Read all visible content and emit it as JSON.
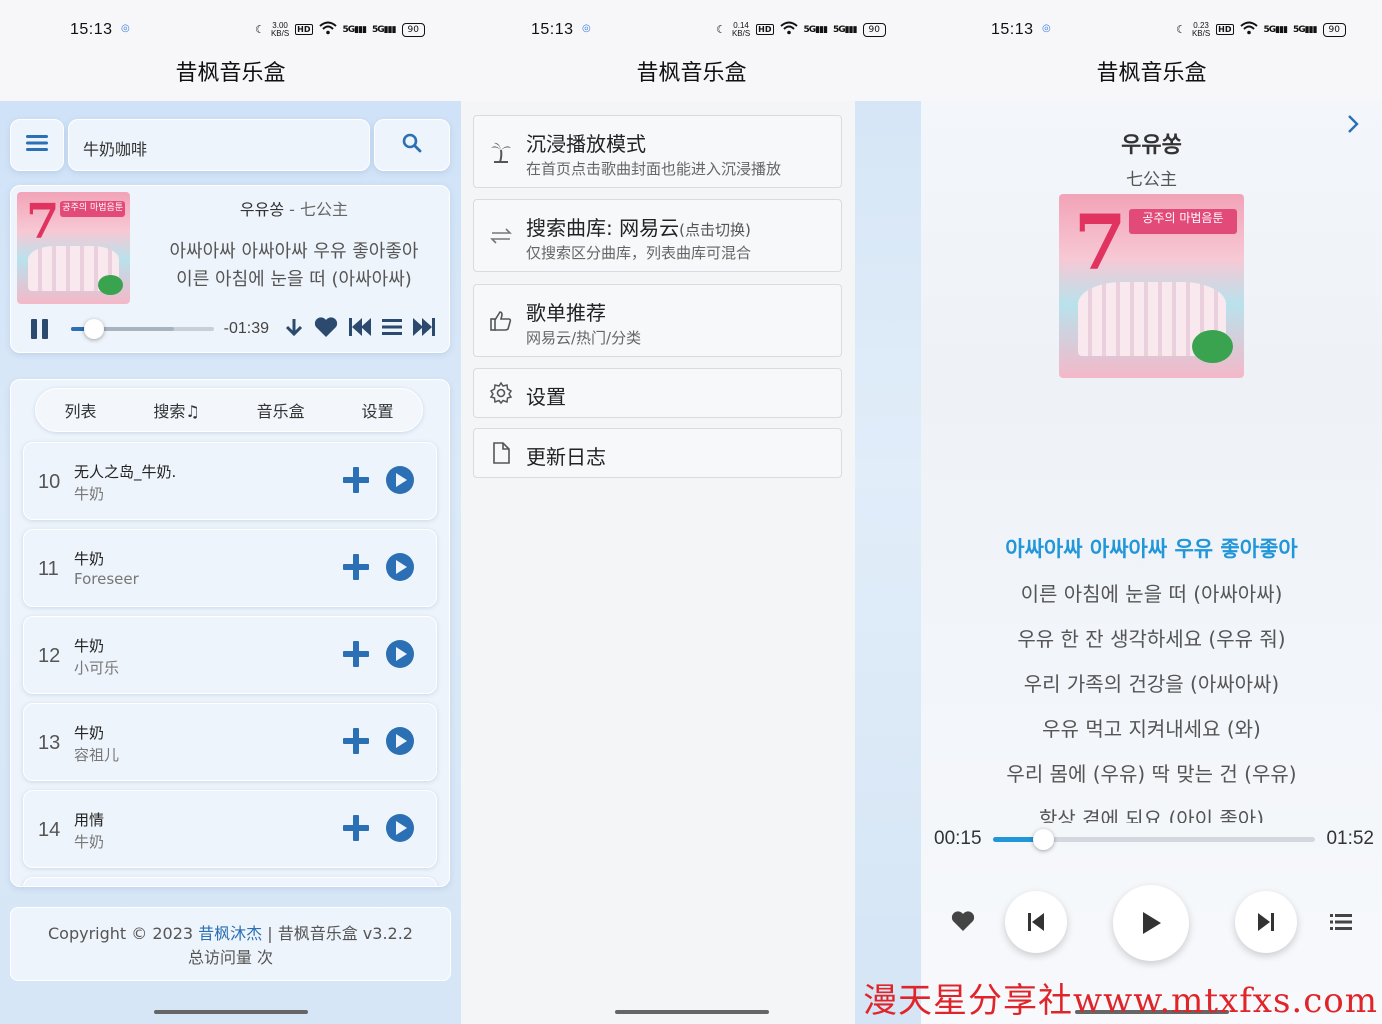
{
  "app_title": "昔枫音乐盒",
  "status_bar": [
    {
      "time": "15:13",
      "speed_value": "3.00",
      "speed_unit": "KB/S",
      "battery": "90"
    },
    {
      "time": "15:13",
      "speed_value": "0.14",
      "speed_unit": "KB/S",
      "battery": "90"
    },
    {
      "time": "15:13",
      "speed_value": "0.23",
      "speed_unit": "KB/S",
      "battery": "90"
    }
  ],
  "search": {
    "query": "牛奶咖啡"
  },
  "now_playing": {
    "title": "우유쏭",
    "separator": " - ",
    "artist": "七公主",
    "lyric_line_1": "아싸아싸 아싸아싸 우유 좋아좋아",
    "lyric_line_2": "이른 아침에 눈을 떠 (아싸아싸)",
    "remaining": "-01:39",
    "progress": 0.16,
    "buffered": 0.72
  },
  "tabs": [
    "列表",
    "搜索♫",
    "音乐盒",
    "设置"
  ],
  "results": [
    {
      "num": "10",
      "title": "无人之岛_牛奶.",
      "artist": "牛奶"
    },
    {
      "num": "11",
      "title": "牛奶",
      "artist": "Foreseer"
    },
    {
      "num": "12",
      "title": "牛奶",
      "artist": "小可乐"
    },
    {
      "num": "13",
      "title": "牛奶",
      "artist": "容祖儿"
    },
    {
      "num": "14",
      "title": "用情",
      "artist": "牛奶"
    }
  ],
  "footer": {
    "copyright": "Copyright © 2023 ",
    "author": "昔枫沐杰",
    "rest": " | 昔枫音乐盒 v3.2.2",
    "visits": "总访问量 次"
  },
  "menu": [
    {
      "title": "沉浸播放模式",
      "sub": "",
      "desc": "在首页点击歌曲封面也能进入沉浸播放",
      "icon": "palm-tree-icon"
    },
    {
      "title": "搜索曲库: 网易云",
      "sub": "(点击切换)",
      "desc": "仅搜索区分曲库，列表曲库可混合",
      "icon": "swap-icon"
    },
    {
      "title": "歌单推荐",
      "sub": "",
      "desc": "网易云/热门/分类",
      "icon": "thumbs-up-icon"
    },
    {
      "title": "设置",
      "sub": "",
      "desc": "",
      "icon": "gear-icon"
    },
    {
      "title": "更新日志",
      "sub": "",
      "desc": "",
      "icon": "document-icon"
    }
  ],
  "player": {
    "title": "우유쏭",
    "artist": "七公主",
    "lyrics": [
      "아싸아싸 아싸아싸 우유 좋아좋아",
      "이른 아침에 눈을 떠 (아싸아싸)",
      "우유 한 잔 생각하세요 (우유 줘)",
      "우리 가족의 건강을 (아싸아싸)",
      "우유 먹고 지켜내세요 (와)",
      "우리 몸에 (우유) 딱 맞는 건 (우유)",
      "항상 곁에 되요 (아이 좋아)"
    ],
    "active_lyric": 0,
    "current_time": "00:15",
    "total_time": "01:52",
    "progress": 0.155
  },
  "cover_text": {
    "seven": "7",
    "banner": "공주의 마법음툰"
  },
  "watermark": "漫天星分享社www.mtxfxs.com",
  "colors": {
    "accent": "#2b6fb4",
    "lyric_active": "#2196d9",
    "watermark": "#e0252a"
  }
}
